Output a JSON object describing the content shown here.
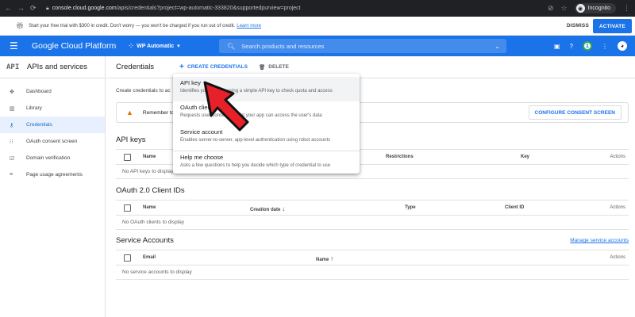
{
  "browser": {
    "url_host": "console.cloud.google.com",
    "url_path": "/apis/credentials?project=wp-automatic-333820&supportedpurview=project",
    "incognito_label": "Incognito"
  },
  "trial_banner": {
    "message": "Start your free trial with $300 in credit. Don't worry — you won't be charged if you run out of credit.",
    "learn_more": "Learn more",
    "dismiss": "DISMISS",
    "activate": "ACTIVATE"
  },
  "topbar": {
    "brand": "Google Cloud Platform",
    "project": "WP Automatic",
    "search_placeholder": "Search products and resources",
    "avatar_initial": "1"
  },
  "sidebar": {
    "api_badge": "API",
    "title": "APIs and services",
    "items": [
      {
        "label": "Dashboard",
        "icon": "dashboard-icon"
      },
      {
        "label": "Library",
        "icon": "library-icon"
      },
      {
        "label": "Credentials",
        "icon": "key-icon"
      },
      {
        "label": "OAuth consent screen",
        "icon": "consent-icon"
      },
      {
        "label": "Domain verification",
        "icon": "checkbox-icon"
      },
      {
        "label": "Page usage agreements",
        "icon": "settings-list-icon"
      }
    ]
  },
  "toolbar": {
    "title": "Credentials",
    "create": "CREATE CREDENTIALS",
    "delete": "DELETE"
  },
  "main": {
    "intro": "Create credentials to ac",
    "banner_text": "Remember to",
    "consent_button": "CONFIGURE CONSENT SCREEN"
  },
  "api_keys": {
    "title": "API keys",
    "columns": [
      "Name",
      "Restrictions",
      "Key",
      "Actions"
    ],
    "empty": "No API keys to display"
  },
  "oauth": {
    "title": "OAuth 2.0 Client IDs",
    "columns": [
      "Name",
      "Creation date",
      "Type",
      "Client ID",
      "Actions"
    ],
    "empty": "No OAuth clients to display"
  },
  "service_accounts": {
    "title": "Service Accounts",
    "manage": "Manage service accounts",
    "columns": [
      "Email",
      "Name",
      "Actions"
    ],
    "empty": "No service accounts to display"
  },
  "dropdown": {
    "options": [
      {
        "title": "API key",
        "desc": "Identifies your project using a simple API key to check quota and access"
      },
      {
        "title": "OAuth client ID",
        "desc": "Requests user consent so that your app can access the user's data"
      },
      {
        "title": "Service account",
        "desc": "Enables server-to-server, app-level authentication using robot accounts"
      },
      {
        "title": "Help me choose",
        "desc": "Asks a few questions to help you decide which type of credential to use"
      }
    ]
  },
  "colors": {
    "brand_blue": "#1a73e8",
    "pointer_red": "#e8202a",
    "warning": "#e37400"
  }
}
